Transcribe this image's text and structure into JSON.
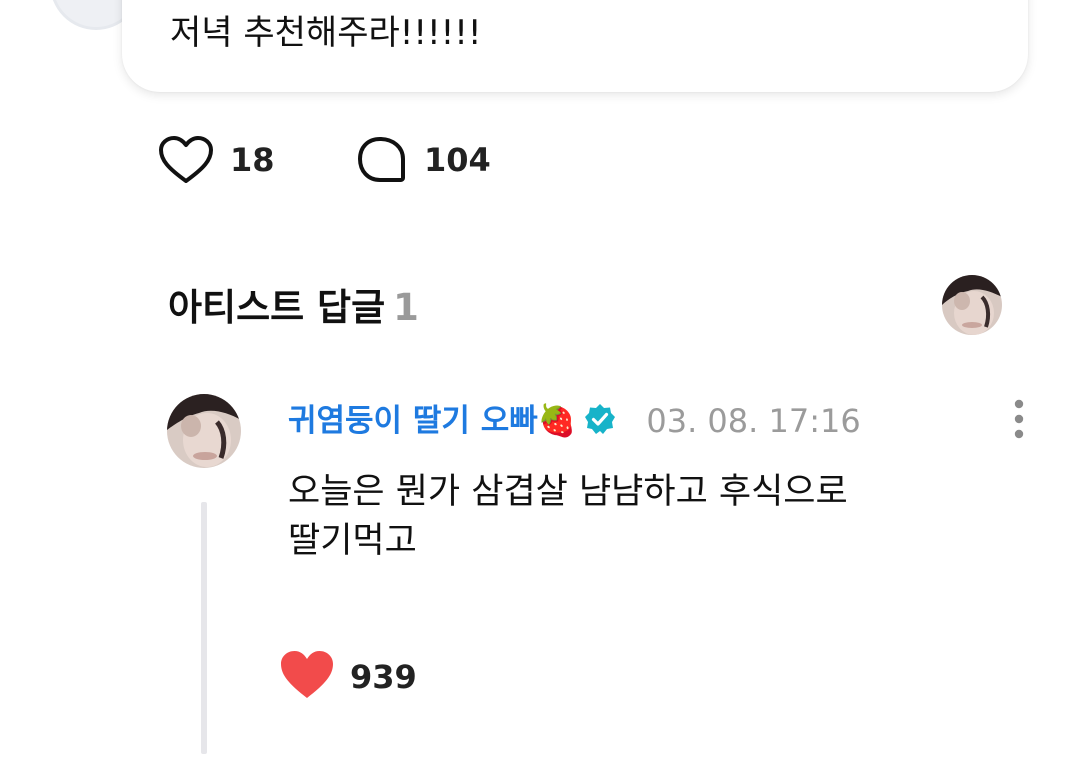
{
  "post": {
    "text": "저녁 추천해주라!!!!!!",
    "like_count": "18",
    "comment_count": "104",
    "like_icon": "heart-outline-icon",
    "comment_icon": "speech-bubble-icon"
  },
  "artist_replies": {
    "title": "아티스트 답글",
    "count": "1"
  },
  "reply": {
    "author": "귀염둥이 딸기 오빠🍓",
    "verified_icon": "verified-badge-icon",
    "date": "03. 08. 17:16",
    "text_line1": "오늘은 뭔가 삼겹살 냠냠하고 후식으로",
    "text_line2": "딸기먹고",
    "like_count": "939",
    "like_icon": "heart-filled-icon",
    "more_icon": "more-vertical-icon"
  },
  "colors": {
    "author": "#1e7ae0",
    "verified": "#17b3c9",
    "heart_filled": "#f24b4b",
    "muted": "#9b9b9b",
    "thread_line": "#e6e6ea"
  }
}
